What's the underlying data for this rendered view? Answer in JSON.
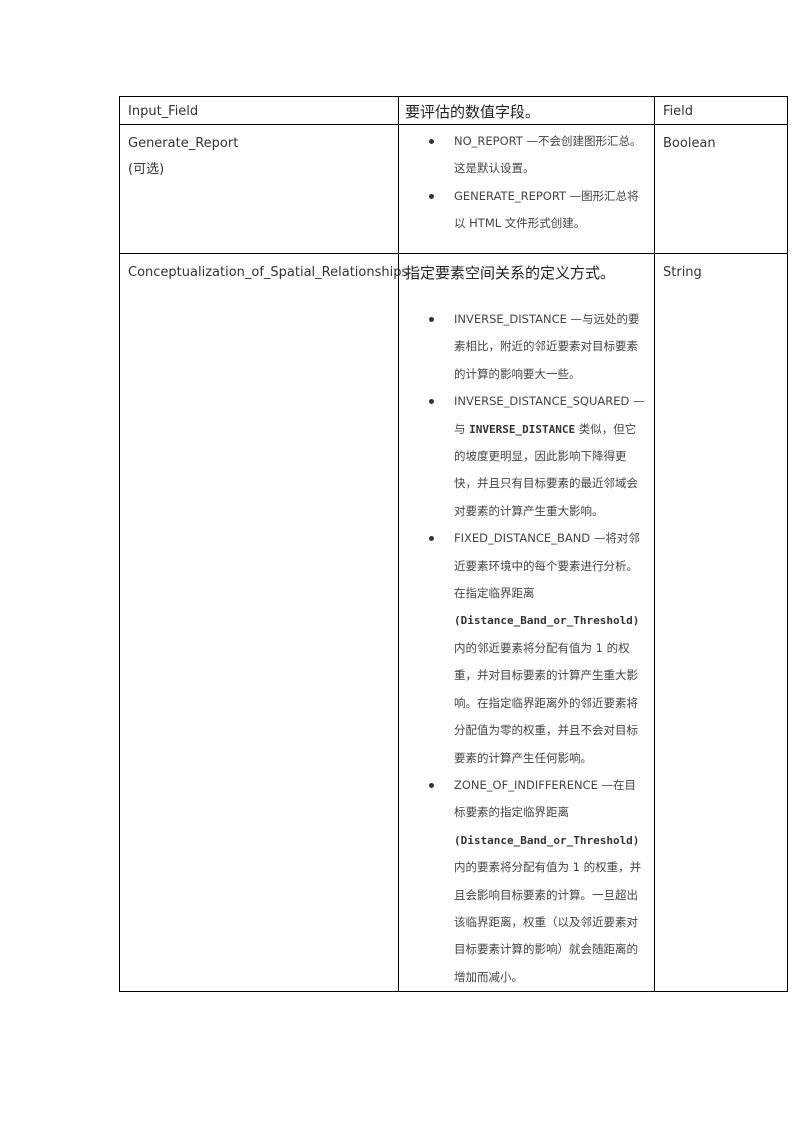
{
  "table": {
    "rows": [
      {
        "name": "Input_Field",
        "description": "要评估的数值字段。",
        "type": "Field"
      },
      {
        "name": "Generate_Report",
        "optional": "(可选)",
        "options": [
          {
            "text": "NO_REPORT —不会创建图形汇总。这是默认设置。"
          },
          {
            "text": "GENERATE_REPORT —图形汇总将以 HTML  文件形式创建。"
          }
        ],
        "type": "Boolean"
      },
      {
        "name": "Conceptualization_of_Spatial_Relationships",
        "description": "指定要素空间关系的定义方式。",
        "options": [
          {
            "text": "INVERSE_DISTANCE —与远处的要素相比，附近的邻近要素对目标要素的计算的影响要大一些。"
          },
          {
            "pre": "INVERSE_DISTANCE_SQUARED —与 ",
            "code": "INVERSE_DISTANCE",
            "post": " 类似，但它的坡度更明显，因此影响下降得更快，并且只有目标要素的最近邻域会对要素的计算产生重大影响。"
          },
          {
            "pre": "FIXED_DISTANCE_BAND —将对邻近要素环境中的每个要素进行分析。在指定临界距离 ",
            "code": "(Distance_Band_or_Threshold)",
            "post": " 内的邻近要素将分配有值为 1 的权重，并对目标要素的计算产生重大影响。在指定临界距离外的邻近要素将分配值为零的权重，并且不会对目标要素的计算产生任何影响。"
          },
          {
            "pre": "ZONE_OF_INDIFFERENCE —在目标要素的指定临界距离 ",
            "code": "(Distance_Band_or_Threshold)",
            "post": " 内的要素将分配有值为 1 的权重，并且会影响目标要素的计算。一旦超出该临界距离，权重（以及邻近要素对目标要素计算的影响）就会随距离的增加而减小。"
          }
        ],
        "type": "String"
      }
    ]
  }
}
